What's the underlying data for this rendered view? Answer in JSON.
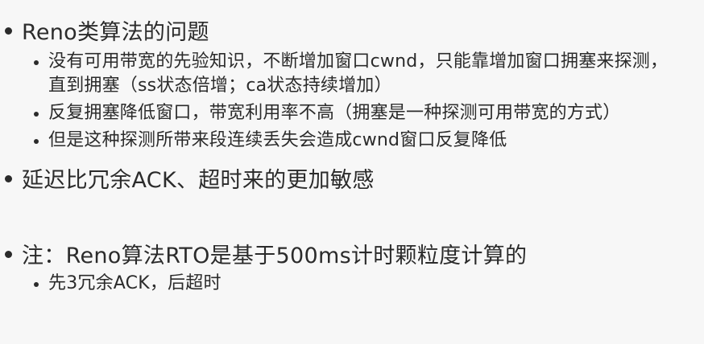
{
  "slide": {
    "items": [
      {
        "text": "Reno类算法的问题",
        "sub": [
          {
            "text": "没有可用带宽的先验知识，不断增加窗口cwnd，只能靠增加窗口拥塞来探测，直到拥塞（ss状态倍增；ca状态持续增加）"
          },
          {
            "text": "反复拥塞降低窗口，带宽利用率不高（拥塞是一种探测可用带宽的方式）"
          },
          {
            "text": "但是这种探测所带来段连续丢失会造成cwnd窗口反复降低"
          }
        ]
      },
      {
        "text": "延迟比冗余ACK、超时来的更加敏感"
      },
      {
        "text": "注：Reno算法RTO是基于500ms计时颗粒度计算的",
        "sub": [
          {
            "text": "先3冗余ACK，后超时"
          }
        ]
      }
    ]
  }
}
